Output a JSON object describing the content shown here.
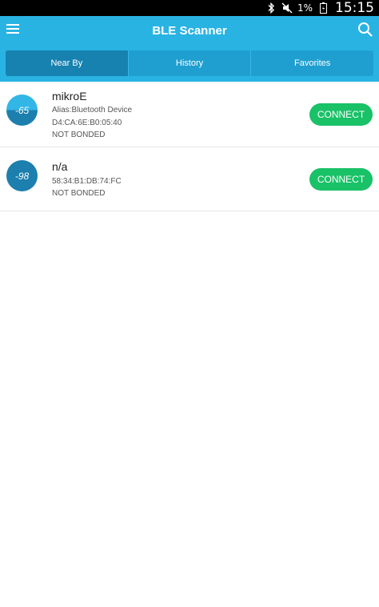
{
  "status_bar": {
    "battery_percent": "1%",
    "time": "15:15",
    "icons": [
      "bluetooth-icon",
      "mute-icon",
      "battery-icon"
    ]
  },
  "app_bar": {
    "title": "BLE Scanner",
    "menu_icon": "menu-icon",
    "search_icon": "search-icon",
    "background": "#29b3e3"
  },
  "tabs": [
    {
      "label": "Near By",
      "active": true
    },
    {
      "label": "History",
      "active": false
    },
    {
      "label": "Favorites",
      "active": false
    }
  ],
  "devices": [
    {
      "rssi": "-65",
      "name": "mikroE",
      "alias": "Alias:Bluetooth Device",
      "address": "D4:CA:6E:B0:05:40",
      "bond_status": "NOT BONDED",
      "action_label": "CONNECT"
    },
    {
      "rssi": "-98",
      "name": "n/a",
      "address": "58:34:B1:DB:74:FC",
      "bond_status": "NOT BONDED",
      "action_label": "CONNECT"
    }
  ],
  "colors": {
    "accent": "#29b3e3",
    "connect_button": "#19c167",
    "rssi_dark": "#1c7fae"
  }
}
